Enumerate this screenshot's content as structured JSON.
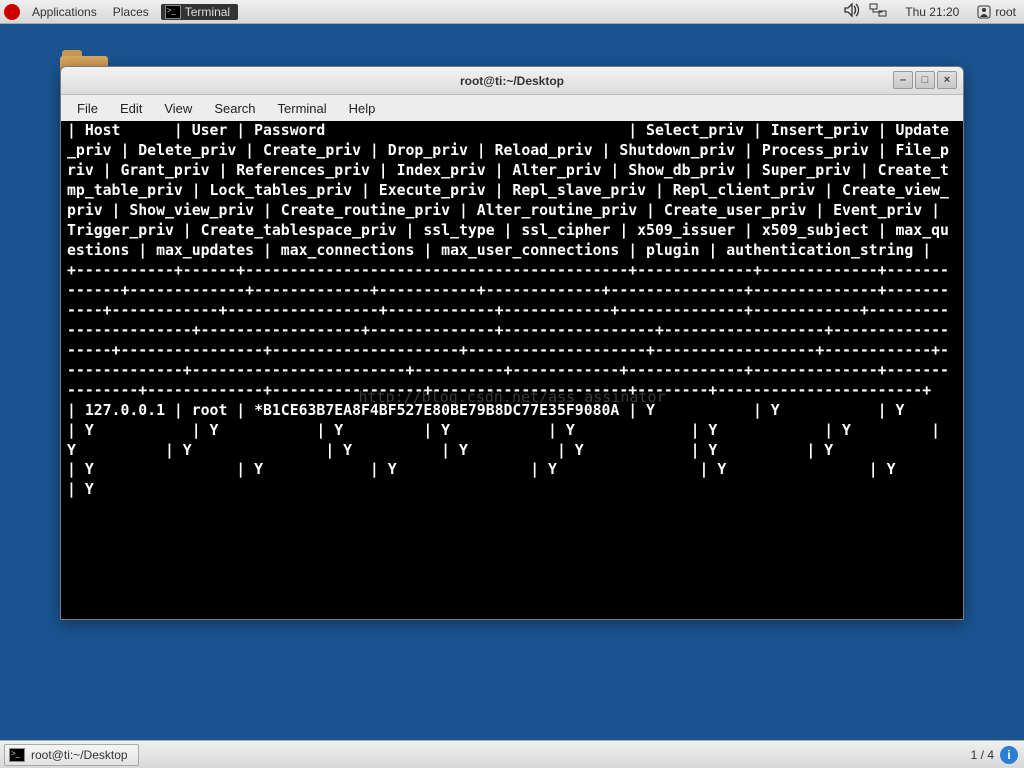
{
  "panel": {
    "applications": "Applications",
    "places": "Places",
    "terminal": "Terminal",
    "clock": "Thu 21:20",
    "user": "root"
  },
  "window": {
    "title": "root@ti:~/Desktop",
    "menus": [
      "File",
      "Edit",
      "View",
      "Search",
      "Terminal",
      "Help"
    ]
  },
  "terminal": {
    "header": "| Host      | User | Password                                  | Select_priv | Insert_priv | Update_priv | Delete_priv | Create_priv | Drop_priv | Reload_priv | Shutdown_priv | Process_priv | File_priv | Grant_priv | References_priv | Index_priv | Alter_priv | Show_db_priv | Super_priv | Create_tmp_table_priv | Lock_tables_priv | Execute_priv | Repl_slave_priv | Repl_client_priv | Create_view_priv | Show_view_priv | Create_routine_priv | Alter_routine_priv | Create_user_priv | Event_priv | Trigger_priv | Create_tablespace_priv | ssl_type | ssl_cipher | x509_issuer | x509_subject | max_questions | max_updates | max_connections | max_user_connections | plugin | authentication_string |",
    "separator": "+-----------+------+-------------------------------------------+-------------+-------------+-------------+-------------+-------------+-----------+-------------+---------------+--------------+-----------+------------+-----------------+------------+------------+--------------+------------+-----------------------+------------------+--------------+-----------------+------------------+------------------+----------------+---------------------+--------------------+------------------+------------+--------------+------------------------+----------+------------+-------------+--------------+---------------+-------------+-----------------+----------------------+--------+-----------------------+",
    "row": "| 127.0.0.1 | root | *B1CE63B7EA8F4BF527E80BE79B8DC77E35F9080A | Y           | Y           | Y           | Y           | Y           | Y         | Y           | Y             | Y            | Y         | Y          | Y               | Y          | Y          | Y            | Y          | Y                     | Y                | Y            | Y               | Y                | Y                | Y              | Y"
  },
  "watermark": "http://blog.csdn.net/ass_assinator",
  "taskbar": {
    "item": "root@ti:~/Desktop",
    "workspace": "1 / 4"
  }
}
